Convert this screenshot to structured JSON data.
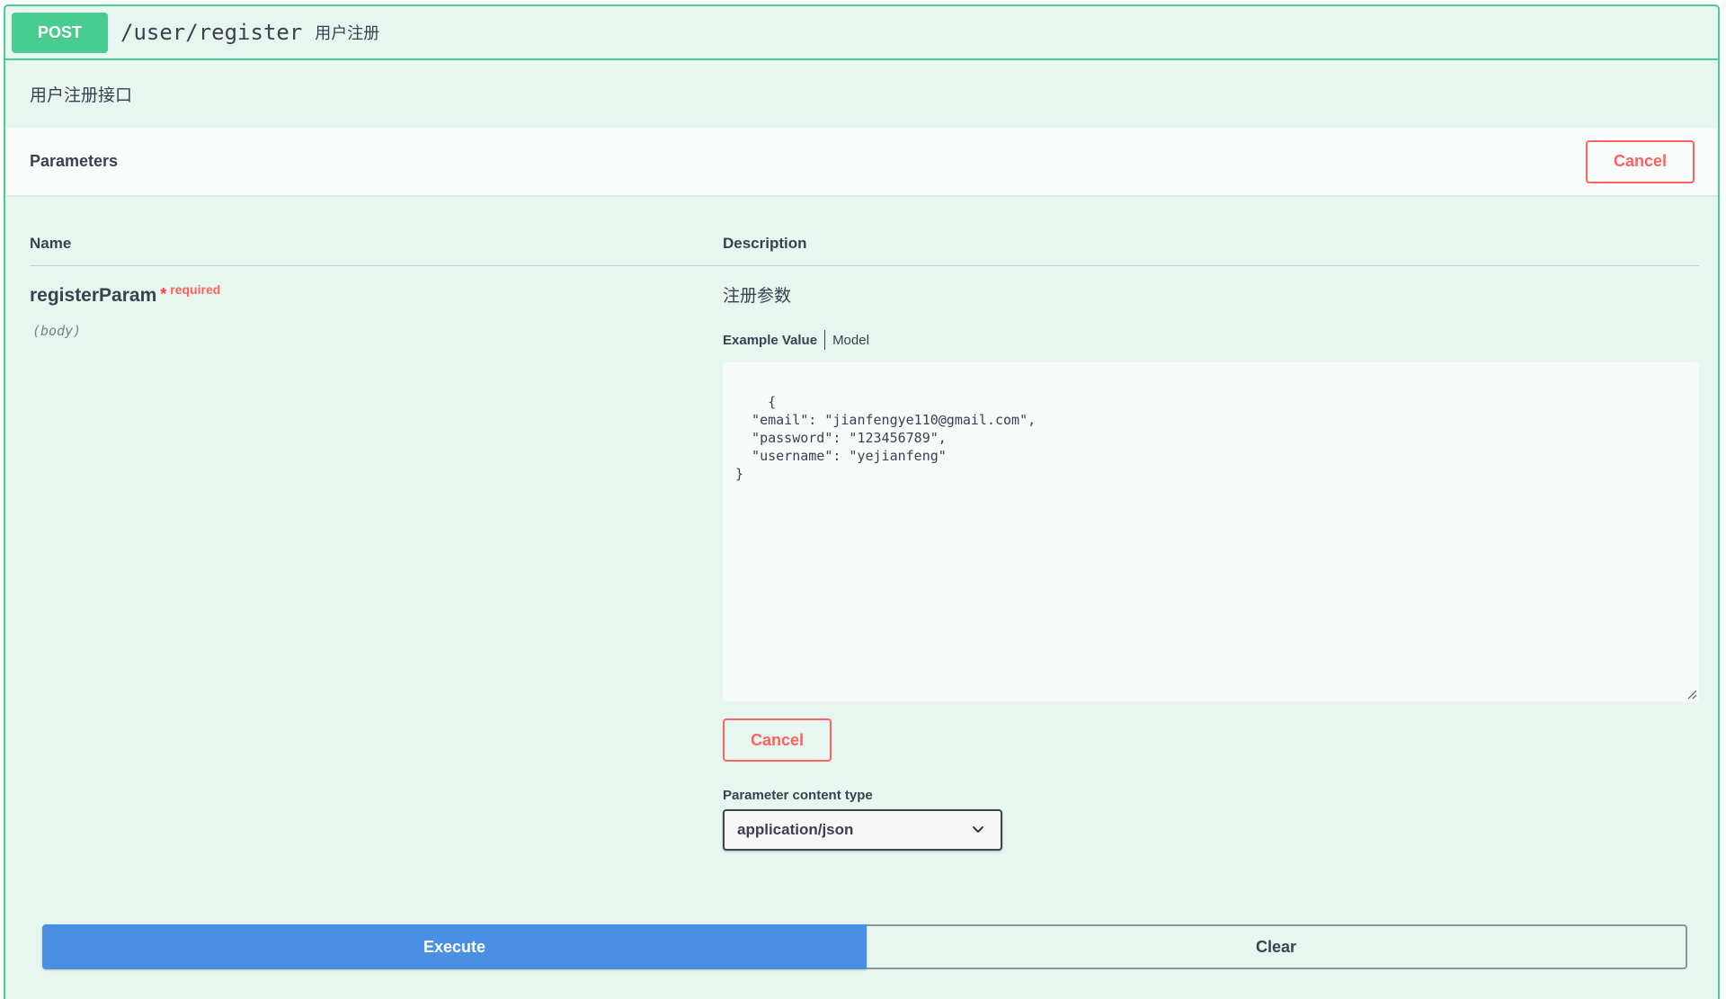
{
  "summary": {
    "method": "POST",
    "path": "/user/register",
    "description": "用户注册"
  },
  "description": "用户注册接口",
  "parameters_section": {
    "title": "Parameters",
    "cancel_label": "Cancel"
  },
  "table": {
    "name_header": "Name",
    "description_header": "Description"
  },
  "param": {
    "name": "registerParam",
    "required_star": "*",
    "required_label": "required",
    "location": "(body)",
    "description": "注册参数",
    "tabs": [
      "Example Value",
      "Model"
    ],
    "example_value": "{\n  \"email\": \"jianfengye110@gmail.com\",\n  \"password\": \"123456789\",\n  \"username\": \"yejianfeng\"\n}",
    "cancel_label": "Cancel"
  },
  "content_type": {
    "label": "Parameter content type",
    "selected": "application/json"
  },
  "actions": {
    "execute_label": "Execute",
    "clear_label": "Clear"
  },
  "colors": {
    "post_green": "#49cc90",
    "block_bg": "#e8f6f0",
    "cancel_red": "#ff6060",
    "execute_blue": "#4990e2"
  },
  "icons": {
    "select_arrow": "chevron-down-icon",
    "resize": "resize-handle-icon"
  }
}
